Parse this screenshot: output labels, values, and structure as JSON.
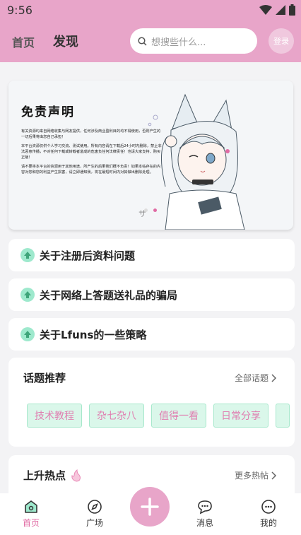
{
  "status_bar": {
    "time": "9:56"
  },
  "header": {
    "tab_home": "首页",
    "tab_discover": "发现",
    "search_placeholder": "想搜些什么...",
    "login_label": "登录"
  },
  "banner": {
    "title": "免责声明",
    "paragraphs": [
      "有关资源均来自网络收集与网友提供，任何涉及商业盈利目的均不得使用，否则产生的一切后果将由您自己承担！",
      "本平台资源仅供个人学习交流、测试使用。所有内容请在下载后24小时内删除，禁止非法恶意传播，不对任何下载或转载者造成的危害负任何法律责任！也请大家支持、购买正版！",
      "请不要将本平台的资源用于其他用途，所产生的后果我们概不负责！如果本帖存在的内容对您和您的利益产生损害，请立即通知我，将在最短时间内对其做出删除处理。"
    ],
    "active_slide": 2
  },
  "notices": [
    {
      "title": "关于注册后资料问题"
    },
    {
      "title": "关于网络上答题送礼品的骗局"
    },
    {
      "title": "关于Lfuns的一些策略"
    }
  ],
  "topics": {
    "heading": "话题推荐",
    "more_label": "全部话题",
    "chips": [
      "技术教程",
      "杂七杂八",
      "值得一看",
      "日常分享"
    ]
  },
  "hot": {
    "heading": "上升热点",
    "more_label": "更多热帖"
  },
  "tabbar": {
    "items": [
      {
        "label": "首页",
        "icon": "home-icon",
        "active": true
      },
      {
        "label": "广场",
        "icon": "compass-icon",
        "active": false
      },
      {
        "label": "消息",
        "icon": "chat-icon",
        "active": false
      },
      {
        "label": "我的",
        "icon": "profile-icon",
        "active": false
      }
    ],
    "fab_icon": "plus-icon"
  },
  "colors": {
    "brand_pink": "#e8a5c9",
    "accent_pink": "#e06aa3",
    "mint": "#9ee9cd",
    "chip_bg": "#daf7ea"
  }
}
